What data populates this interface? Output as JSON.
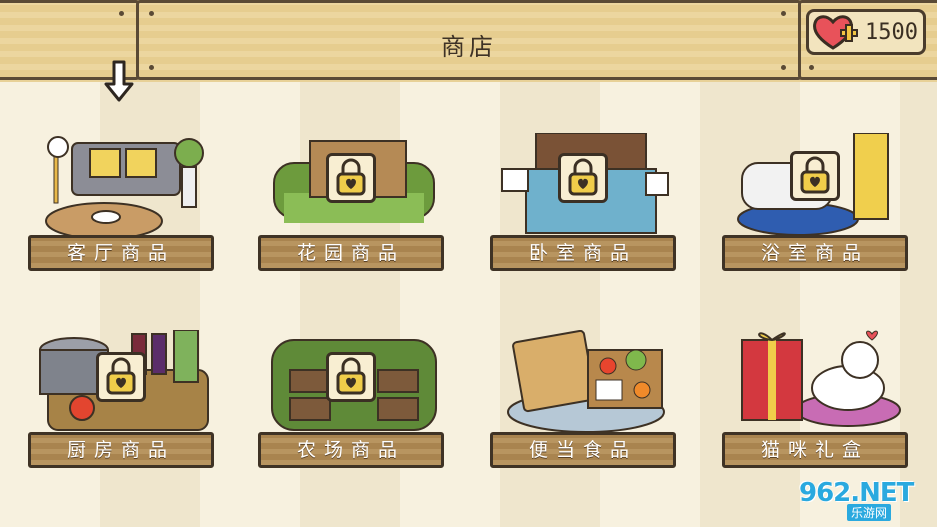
{
  "header": {
    "title": "商店",
    "currency_amount": "1500",
    "currency_icon": "heart-plus-icon"
  },
  "shop": {
    "items": [
      {
        "label": "客厅商品",
        "locked": false,
        "icon": "living-room-scene"
      },
      {
        "label": "花园商品",
        "locked": true,
        "icon": "garden-scene"
      },
      {
        "label": "卧室商品",
        "locked": true,
        "icon": "bedroom-scene"
      },
      {
        "label": "浴室商品",
        "locked": true,
        "icon": "bathroom-scene"
      },
      {
        "label": "厨房商品",
        "locked": true,
        "icon": "kitchen-scene"
      },
      {
        "label": "农场商品",
        "locked": true,
        "icon": "farm-scene"
      },
      {
        "label": "便当食品",
        "locked": false,
        "icon": "bento-scene"
      },
      {
        "label": "猫咪礼盒",
        "locked": false,
        "icon": "cat-gift-scene"
      }
    ]
  },
  "watermark": {
    "brand": "962.NET",
    "sub": "乐游网"
  },
  "colors": {
    "wood": "#b89560",
    "outline": "#3f3325",
    "background": "#f6f0dd",
    "accent_blue": "#2aa9df"
  }
}
